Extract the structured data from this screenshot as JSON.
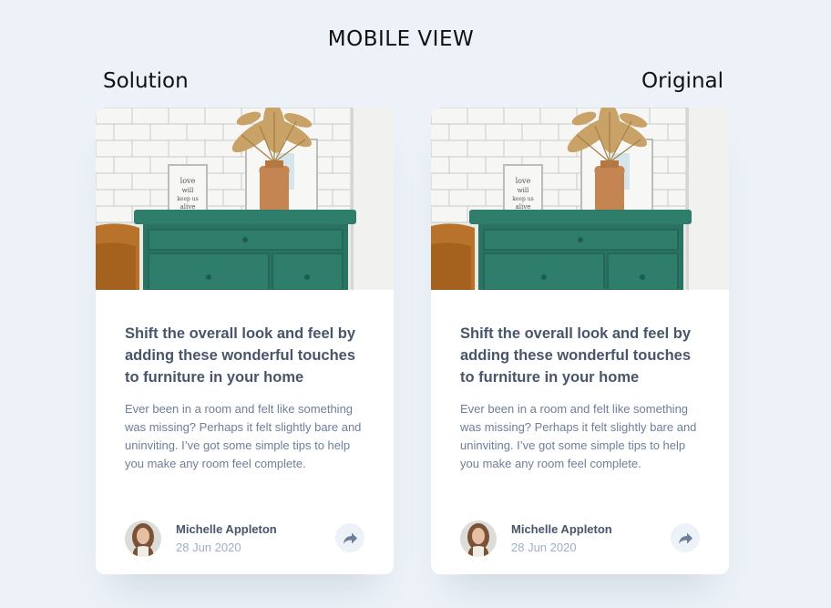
{
  "page": {
    "heading": "MOBILE VIEW",
    "labels": {
      "solution": "Solution",
      "original": "Original"
    }
  },
  "cards": [
    {
      "title": "Shift the overall look and feel by adding these wonderful touches to furniture in your home",
      "description": "Ever been in a room and felt like something was missing? Perhaps it felt slightly bare and uninviting. I’ve got some simple tips to help you make any room feel complete.",
      "author": {
        "name": "Michelle Appleton",
        "date": "28 Jun 2020"
      },
      "share_icon": "share-icon"
    },
    {
      "title": "Shift the overall look and feel by adding these wonderful touches to furniture in your home",
      "description": "Ever been in a room and felt like something was missing? Perhaps it felt slightly bare and uninviting. I’ve got some simple tips to help you make any room feel complete.",
      "author": {
        "name": "Michelle Appleton",
        "date": "28 Jun 2020"
      },
      "share_icon": "share-icon"
    }
  ],
  "colors": {
    "background": "#ecf2f8",
    "title": "#48556a",
    "text": "#6d7f97",
    "muted": "#9eafc2",
    "drawer_green": "#2f7d6b"
  }
}
